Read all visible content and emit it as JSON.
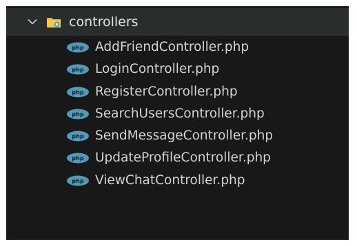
{
  "explorer": {
    "folder": {
      "name": "controllers",
      "expanded": true,
      "chevron_icon": "chevron-down-icon",
      "folder_icon": "folder-controller-icon"
    },
    "files": [
      {
        "name": "AddFriendController.php",
        "icon": "php-icon"
      },
      {
        "name": "LoginController.php",
        "icon": "php-icon"
      },
      {
        "name": "RegisterController.php",
        "icon": "php-icon"
      },
      {
        "name": "SearchUsersController.php",
        "icon": "php-icon"
      },
      {
        "name": "SendMessageController.php",
        "icon": "php-icon"
      },
      {
        "name": "UpdateProfileController.php",
        "icon": "php-icon"
      },
      {
        "name": "ViewChatController.php",
        "icon": "php-icon"
      }
    ],
    "colors": {
      "background": "#181818",
      "folder_row_background": "#2a2d2e",
      "text": "#d4d4d4",
      "php_icon": "#519aba",
      "folder_icon": "#e8b923",
      "folder_gear": "#4aa3df"
    }
  }
}
